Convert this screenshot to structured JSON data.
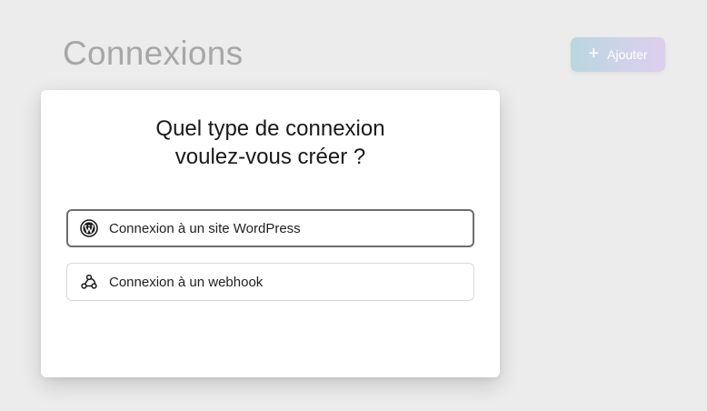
{
  "header": {
    "title": "Connexions",
    "add_button_icon": "plus-icon",
    "add_button_label": "Ajouter",
    "add_button_gradient": [
      "#b9d6df",
      "#dccfee"
    ]
  },
  "modal": {
    "title_line1": "Quel type de connexion",
    "title_line2": "voulez-vous créer ?",
    "options": [
      {
        "icon": "wordpress-icon",
        "label": "Connexion à un site WordPress",
        "selected": true
      },
      {
        "icon": "webhook-icon",
        "label": "Connexion à un webhook",
        "selected": false
      }
    ]
  }
}
